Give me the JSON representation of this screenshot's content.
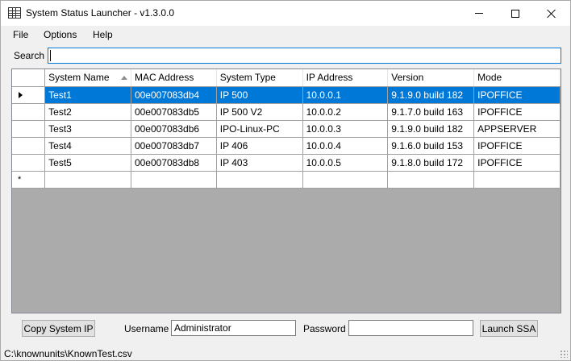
{
  "window": {
    "title": "System Status Launcher - v1.3.0.0",
    "icon": "grid-table-icon"
  },
  "menu": {
    "items": [
      "File",
      "Options",
      "Help"
    ]
  },
  "search": {
    "label": "Search",
    "value": ""
  },
  "grid": {
    "columns": [
      "System Name",
      "MAC Address",
      "System Type",
      "IP Address",
      "Version",
      "Mode"
    ],
    "sorted_column": "System Name",
    "sort_direction": "ascending",
    "selected_row": 0,
    "rows": [
      [
        "Test1",
        "00e007083db4",
        "IP 500",
        "10.0.0.1",
        "9.1.9.0 build 182",
        "IPOFFICE"
      ],
      [
        "Test2",
        "00e007083db5",
        "IP 500 V2",
        "10.0.0.2",
        "9.1.7.0 build 163",
        "IPOFFICE"
      ],
      [
        "Test3",
        "00e007083db6",
        "IPO-Linux-PC",
        "10.0.0.3",
        "9.1.9.0 build 182",
        "APPSERVER"
      ],
      [
        "Test4",
        "00e007083db7",
        "IP 406",
        "10.0.0.4",
        "9.1.6.0 build 153",
        "IPOFFICE"
      ],
      [
        "Test5",
        "00e007083db8",
        "IP 403",
        "10.0.0.5",
        "9.1.8.0 build 172",
        "IPOFFICE"
      ]
    ],
    "new_row_glyph": "*"
  },
  "footer": {
    "copy_button": "Copy System IP",
    "username_label": "Username",
    "username_value": "Administrator",
    "password_label": "Password",
    "password_value": "",
    "launch_button": "Launch SSA"
  },
  "status": {
    "text": "C:\\knownunits\\KnownTest.csv"
  },
  "colors": {
    "selection": "#0078d7",
    "grid_background": "#ababab",
    "window_background": "#f0f0f0"
  }
}
